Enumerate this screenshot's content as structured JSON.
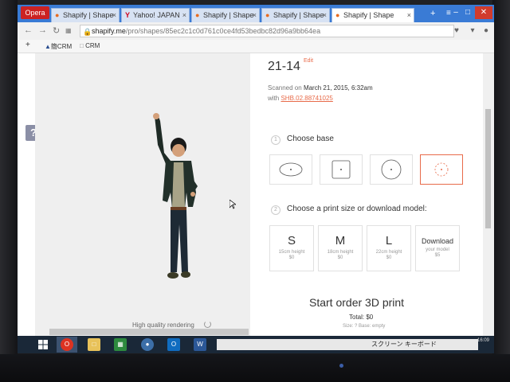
{
  "browser": {
    "opera_label": "Opera",
    "tabs": [
      {
        "label": "Shapify | Shape",
        "favicon": "shapify-icon"
      },
      {
        "label": "Yahoo! JAPAN",
        "favicon": "yahoo-icon"
      },
      {
        "label": "Shapify | Shape",
        "favicon": "shapify-icon"
      },
      {
        "label": "Shapify | Shape",
        "favicon": "shapify-icon"
      },
      {
        "label": "Shapify | Shape",
        "favicon": "shapify-icon",
        "active": true
      }
    ],
    "url_host": "shapify.me",
    "url_path": "/pro/shapes/85ec2c1c0d761c0ce4fd53bedbc82d96a9bb64ea",
    "bookmarks": [
      {
        "label": "+"
      },
      {
        "label": "CRM",
        "prefix": "簡"
      },
      {
        "label": "CRM"
      }
    ]
  },
  "viewer": {
    "help_label": "?",
    "quality_label": "High quality rendering"
  },
  "model": {
    "title": "21-14",
    "edit_label": "Edit",
    "scanned_prefix": "Scanned on",
    "scanned_when": "March 21, 2015, 6:32am",
    "with_prefix": "with",
    "device": "SHB.02.88741025"
  },
  "steps": {
    "base": {
      "number": "1",
      "title": "Choose base",
      "options": [
        "ellipse",
        "square",
        "circle",
        "circle-dashed"
      ],
      "selected": 3
    },
    "size": {
      "number": "2",
      "title": "Choose a print size or download model:",
      "options": [
        {
          "letter": "S",
          "height": "15cm height",
          "price": "$0"
        },
        {
          "letter": "M",
          "height": "18cm height",
          "price": "$0"
        },
        {
          "letter": "L",
          "height": "22cm height",
          "price": "$0"
        },
        {
          "letter": "Download",
          "height": "your model",
          "price": "$5"
        }
      ]
    }
  },
  "order": {
    "title": "Start order 3D print",
    "total": "Total: $0",
    "size_base": "Size: ?  Base: empty"
  },
  "taskbar": {
    "osk_label": "スクリーン キーボード",
    "clock": "16:09"
  },
  "colors": {
    "accent": "#e86b4a",
    "tabbar": "#3a7bd5",
    "taskbar": "#1a2838"
  }
}
